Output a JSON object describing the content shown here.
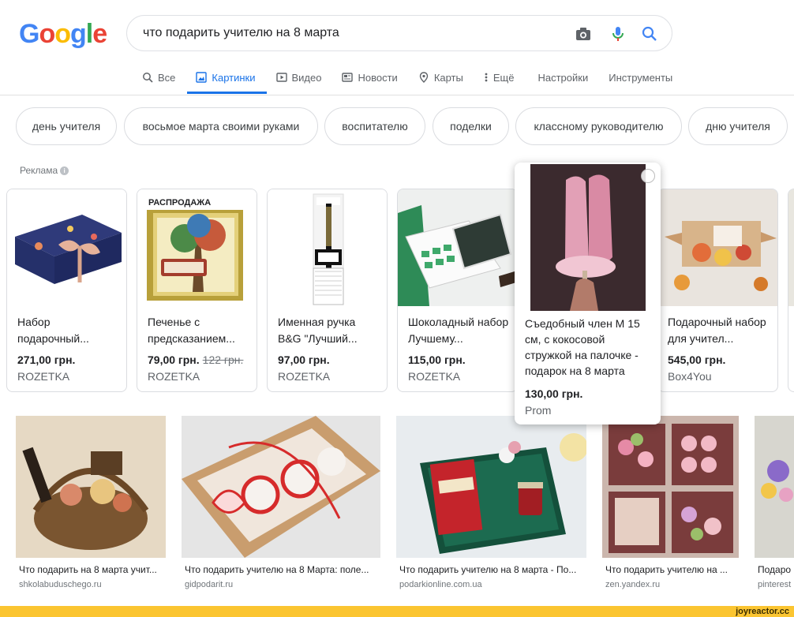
{
  "logo": {
    "letters": [
      "G",
      "o",
      "o",
      "g",
      "l",
      "e"
    ],
    "colors": [
      "#4285F4",
      "#EA4335",
      "#FBBC05",
      "#4285F4",
      "#34A853",
      "#EA4335"
    ]
  },
  "search": {
    "query": "что подарить учителю на 8 марта"
  },
  "tabs": [
    {
      "label": "Все",
      "icon": "search-icon"
    },
    {
      "label": "Картинки",
      "icon": "image-icon",
      "active": true
    },
    {
      "label": "Видео",
      "icon": "play-icon"
    },
    {
      "label": "Новости",
      "icon": "newspaper-icon"
    },
    {
      "label": "Карты",
      "icon": "map-pin-icon"
    },
    {
      "label": "Ещё",
      "icon": "more-vert-icon"
    },
    {
      "label": "Настройки"
    },
    {
      "label": "Инструменты"
    }
  ],
  "chips": [
    "день учителя",
    "восьмое марта своими руками",
    "воспитателю",
    "поделки",
    "классному руководителю",
    "дню учителя"
  ],
  "ads_label": "Реклама",
  "products": [
    {
      "title": "Набор подарочный...",
      "price": "271,00 грн.",
      "store": "ROZETKA"
    },
    {
      "title": "Печенье с предсказанием...",
      "price": "79,00 грн.",
      "old_price": "122 грн.",
      "store": "ROZETKA",
      "badge": "РАСПРОДАЖА"
    },
    {
      "title": "Именная ручка B&G \"Лучший...",
      "price": "97,00 грн.",
      "store": "ROZETKA"
    },
    {
      "title": "Шоколадный набор Лучшему...",
      "price": "115,00 грн.",
      "store": "ROZETKA"
    },
    {
      "title": "Подарочный набор для учител...",
      "price": "545,00 грн.",
      "store": "Box4You"
    }
  ],
  "hover_product": {
    "title": "Съедобный член М 15 см, с кокосовой стружкой на палочке - подарок на 8 марта",
    "price": "130,00 грн.",
    "store": "Prom"
  },
  "results": [
    {
      "title": "Что подарить на 8 марта учит...",
      "source": "shkolabuduschego.ru"
    },
    {
      "title": "Что подарить учителю на 8 Марта: поле...",
      "source": "gidpodarit.ru"
    },
    {
      "title": "Что подарить учителю на 8 марта - По...",
      "source": "podarkionline.com.ua"
    },
    {
      "title": "Что подарить учителю на ...",
      "source": "zen.yandex.ru"
    },
    {
      "title": "Подаро",
      "source": "pinterest"
    }
  ],
  "watermark": "joyreactor.cc"
}
